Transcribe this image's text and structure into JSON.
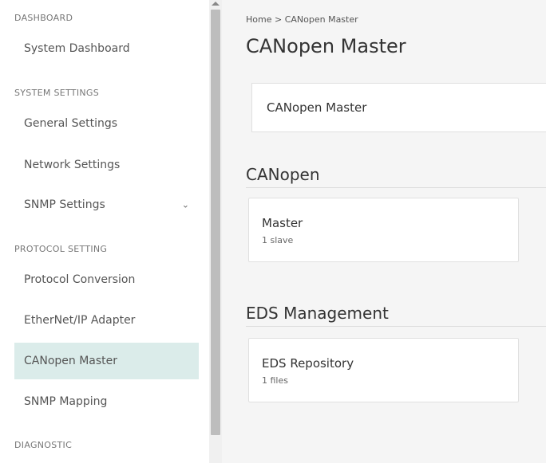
{
  "sidebar": {
    "sections": [
      {
        "title": "DASHBOARD"
      },
      {
        "title": "SYSTEM SETTINGS"
      },
      {
        "title": "PROTOCOL SETTING"
      },
      {
        "title": "DIAGNOSTIC"
      }
    ],
    "items": [
      {
        "label": "System Dashboard"
      },
      {
        "label": "General Settings"
      },
      {
        "label": "Network Settings"
      },
      {
        "label": "SNMP Settings",
        "icon": "chevron-down-icon"
      },
      {
        "label": "Protocol Conversion"
      },
      {
        "label": "EtherNet/IP Adapter"
      },
      {
        "label": "CANopen Master",
        "active": true
      },
      {
        "label": "SNMP Mapping"
      }
    ],
    "chevron": "⌄",
    "active_color": "#dbecea"
  },
  "breadcrumb": {
    "text": "Home > CANopen Master"
  },
  "page": {
    "title": "CANopen Master"
  },
  "top_card": {
    "label": "CANopen Master"
  },
  "sections": {
    "canopen": {
      "heading": "CANopen",
      "card": {
        "title": "Master",
        "subtitle": "1 slave"
      }
    },
    "eds": {
      "heading": "EDS Management",
      "card": {
        "title": "EDS Repository",
        "subtitle": "1 files"
      }
    }
  }
}
